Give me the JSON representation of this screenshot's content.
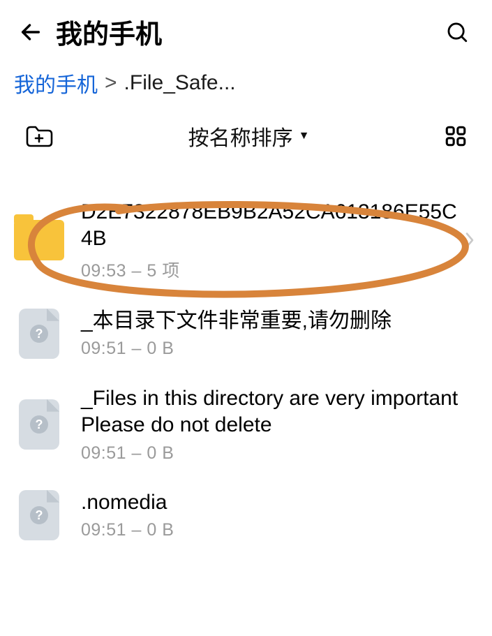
{
  "header": {
    "title": "我的手机"
  },
  "breadcrumb": {
    "root": "我的手机",
    "separator": ">",
    "current": ".File_Safe..."
  },
  "toolbar": {
    "sort_label": "按名称排序"
  },
  "items": [
    {
      "type": "folder",
      "name": "D2E7322878EB9B2A52CA613186E55C4B",
      "meta": "09:53 – 5 项",
      "chevron": true
    },
    {
      "type": "file",
      "name": "_本目录下文件非常重要,请勿删除",
      "meta": "09:51 – 0 B",
      "chevron": false
    },
    {
      "type": "file",
      "name": "_Files in this directory are very important Please do not delete",
      "meta": "09:51 – 0 B",
      "chevron": false
    },
    {
      "type": "file",
      "name": ".nomedia",
      "meta": "09:51 – 0 B",
      "chevron": false
    }
  ],
  "annotation": {
    "color": "#d8843b"
  }
}
